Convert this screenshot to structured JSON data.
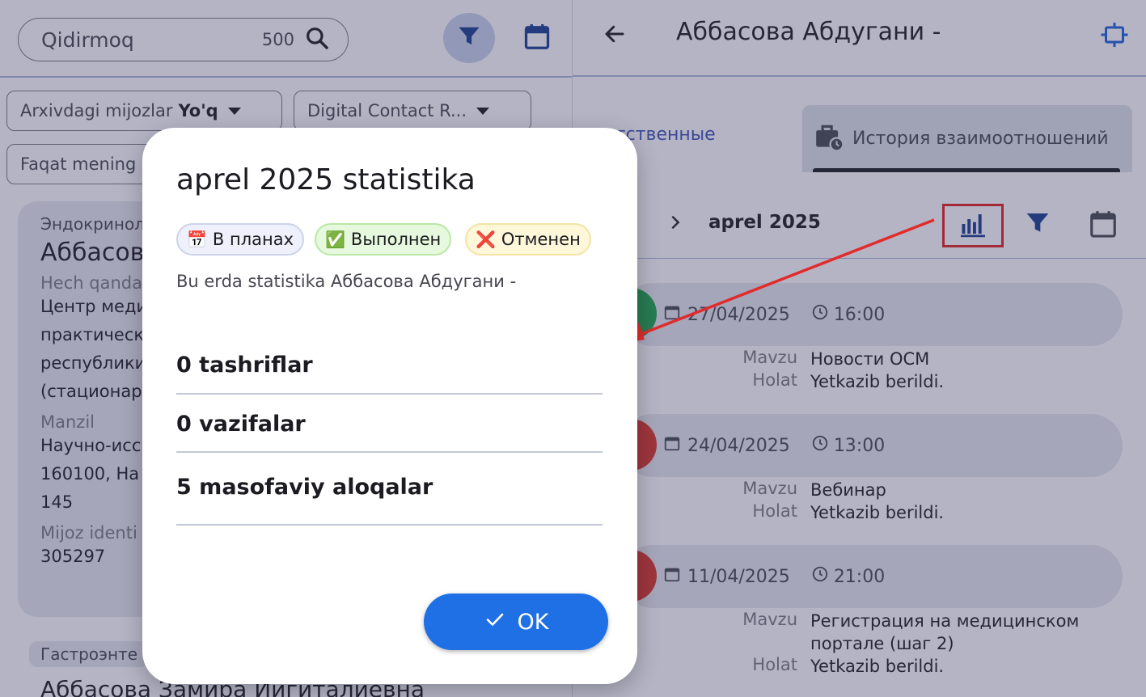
{
  "left": {
    "search": {
      "placeholder": "Qidirmoq",
      "count": "500"
    },
    "chips": [
      {
        "label": "Arxivdagi mijozlar",
        "value": "Yo'q"
      },
      {
        "label": "Digital Contact R...",
        "value": ""
      },
      {
        "label": "Faqat mening",
        "value": ""
      }
    ],
    "card": {
      "tag": "Эндокринол",
      "name": "Аббасова",
      "label1": "Hech qanday",
      "value1": [
        "Центр меди",
        "практическ",
        "республики",
        "(стационар"
      ],
      "label2": "Manzil",
      "value2": [
        "Научно-исс",
        "160100, На",
        "145"
      ],
      "label3": "Mijoz identi",
      "value3": "305297"
    },
    "card2": {
      "tag": "Гастроэнте",
      "name": "Аббасова Замира Иигиталиевна"
    }
  },
  "right": {
    "title": "Аббасова Абдугани -",
    "tab_responsible": "ответственные",
    "tab_history": "История взаимоотношений",
    "month": "aprel 2025",
    "events": [
      {
        "date": "27/04/2025",
        "time": "16:00",
        "topic_label": "Mavzu",
        "topic": "Новости ОСМ",
        "status_label": "Holat",
        "status": "Yetkazib berildi.",
        "color": "#1e9e4a"
      },
      {
        "date": "24/04/2025",
        "time": "13:00",
        "topic_label": "Mavzu",
        "topic": "Вебинар",
        "status_label": "Holat",
        "status": "Yetkazib berildi.",
        "color": "#d8322a"
      },
      {
        "date": "11/04/2025",
        "time": "21:00",
        "topic_label": "Mavzu",
        "topic": "Регистрация на медицинском портале (шаг 2)",
        "status_label": "Holat",
        "status": "Yetkazib berildi.",
        "color": "#d8322a"
      }
    ]
  },
  "modal": {
    "title": "aprel 2025 statistika",
    "legend": [
      {
        "icon": "calendar-emoji",
        "glyph": "📅",
        "label": "В планах"
      },
      {
        "icon": "check-mark-emoji",
        "glyph": "✅",
        "label": "Выполнен"
      },
      {
        "icon": "cross-mark-emoji",
        "glyph": "❌",
        "label": "Отменен"
      }
    ],
    "subtitle": "Bu erda statistika Аббасова Абдугани -",
    "stats": [
      "0 tashriflar",
      "0 vazifalar",
      "5 masofaviy aloqalar"
    ],
    "ok_label": "OK"
  },
  "colors": {
    "accent": "#1f6fe5",
    "highlight": "#e01f1f",
    "scrim": "#383e60"
  }
}
